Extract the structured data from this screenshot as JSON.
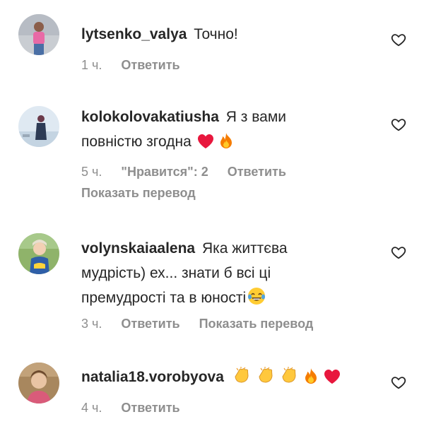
{
  "comments": [
    {
      "username": "lytsenko_valya",
      "text": "Точно!",
      "time": "1 ч.",
      "reply_label": "Ответить"
    },
    {
      "username": "kolokolovakatiusha",
      "text_line1": "Я з вами",
      "text_line2": "повністю згодна",
      "emojis": [
        "red-heart",
        "fire"
      ],
      "time": "5 ч.",
      "likes": "\"Нравится\": 2",
      "reply_label": "Ответить",
      "translate_label": "Показать перевод"
    },
    {
      "username": "volynskaiaalena",
      "text_line1": "Яка життєва",
      "text_line2": "мудрість) ех... знати б всі ці",
      "text_line3": "премудрості та в юності",
      "emojis": [
        "face-with-tears-of-joy"
      ],
      "time": "3 ч.",
      "reply_label": "Ответить",
      "translate_label": "Показать перевод"
    },
    {
      "username": "natalia18.vorobyova",
      "emojis": [
        "clapping-hands",
        "clapping-hands",
        "clapping-hands",
        "fire",
        "red-heart"
      ],
      "time": "4 ч.",
      "reply_label": "Ответить"
    }
  ],
  "colors": {
    "text": "#262626",
    "muted": "#8e8e8e",
    "heart_red": "#e8173d"
  },
  "icons": {
    "like": "heart-outline-icon"
  }
}
